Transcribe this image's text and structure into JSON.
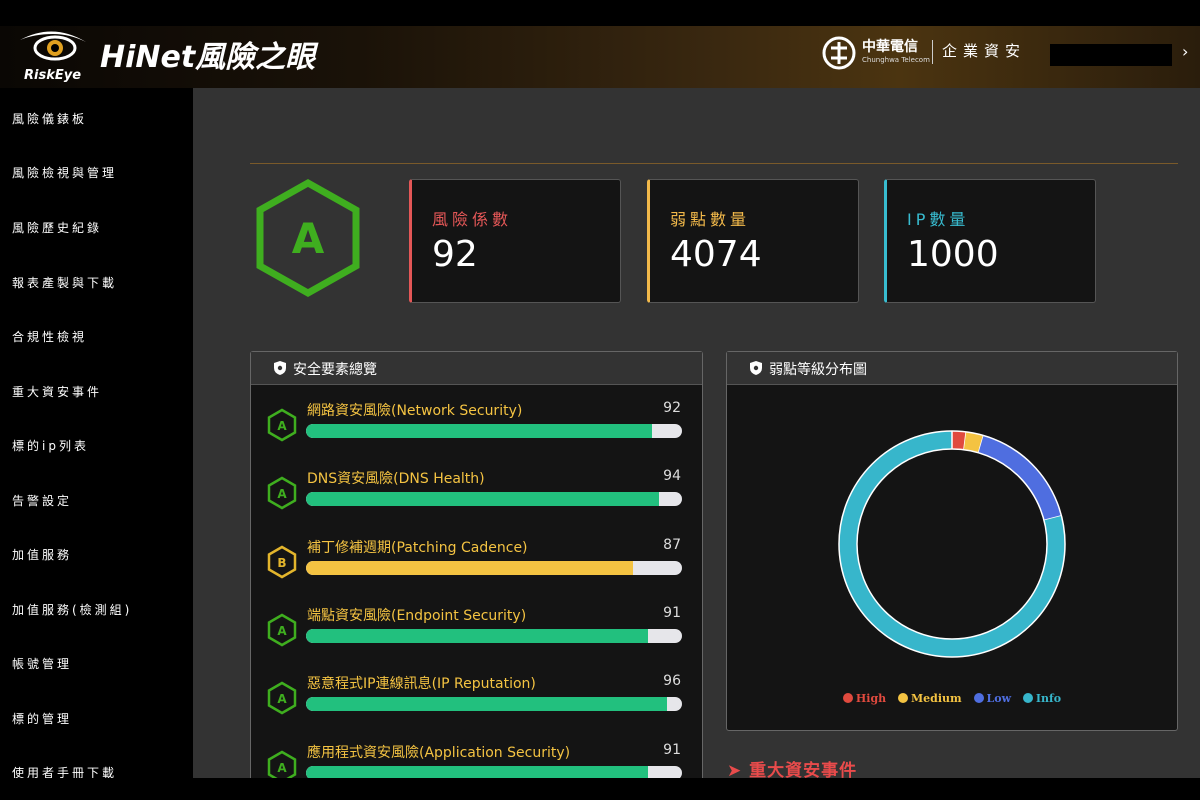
{
  "header": {
    "logo_text": "RiskEye",
    "app_title": "HiNet風險之眼",
    "company_name": "中華電信",
    "company_sub": "Chunghwa Telecom",
    "section": "企業資安"
  },
  "sidebar": {
    "items": [
      {
        "label": "風險儀錶板"
      },
      {
        "label": "風險檢視與管理"
      },
      {
        "label": "風險歷史紀錄"
      },
      {
        "label": "報表產製與下載"
      },
      {
        "label": "合規性檢視"
      },
      {
        "label": "重大資安事件"
      },
      {
        "label": "標的ip列表"
      },
      {
        "label": "告警設定"
      },
      {
        "label": "加值服務"
      },
      {
        "label": "加值服務(檢測組)"
      },
      {
        "label": "帳號管理"
      },
      {
        "label": "標的管理"
      },
      {
        "label": "使用者手冊下載"
      }
    ]
  },
  "overall_grade": "A",
  "stats": [
    {
      "label": "風險係數",
      "value": "92",
      "color": "#e45757"
    },
    {
      "label": "弱點數量",
      "value": "4074",
      "color": "#f2b94a"
    },
    {
      "label": "IP數量",
      "value": "1000",
      "color": "#38bcd0"
    }
  ],
  "security_panel": {
    "title": "安全要素總覽",
    "rows": [
      {
        "grade": "A",
        "label": "網路資安風險(Network Security)",
        "score": 92
      },
      {
        "grade": "A",
        "label": "DNS資安風險(DNS Health)",
        "score": 94
      },
      {
        "grade": "B",
        "label": "補丁修補週期(Patching Cadence)",
        "score": 87
      },
      {
        "grade": "A",
        "label": "端點資安風險(Endpoint Security)",
        "score": 91
      },
      {
        "grade": "A",
        "label": "惡意程式IP連線訊息(IP Reputation)",
        "score": 96
      },
      {
        "grade": "A",
        "label": "應用程式資安風險(Application Security)",
        "score": 91
      }
    ]
  },
  "chart_data": {
    "type": "pie",
    "title": "弱點等級分布圖",
    "categories": [
      "High",
      "Medium",
      "Low",
      "Info"
    ],
    "values": [
      2,
      2.5,
      16.5,
      79
    ],
    "colors": [
      "#e04a3e",
      "#f4c342",
      "#4f6ee0",
      "#37b6cb"
    ]
  },
  "events_title": "重大資安事件",
  "colors": {
    "grade_a": "#3fae1f",
    "grade_b": "#e3b52c",
    "bar_green": "#22c07e",
    "bar_yellow": "#f4c342"
  }
}
